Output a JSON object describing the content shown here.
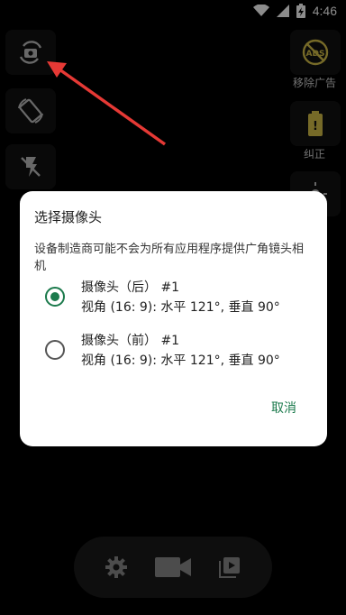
{
  "status": {
    "time": "4:46"
  },
  "right_rail": {
    "ads_label": "移除广告",
    "straighten_label": "纠正"
  },
  "dialog": {
    "title": "选择摄像头",
    "description": "设备制造商可能不会为所有应用程序提供广角镜头相机",
    "options": [
      {
        "title": "摄像头（后） #1",
        "detail": "视角 (16: 9): 水平 121°, 垂直 90°",
        "selected": true
      },
      {
        "title": "摄像头（前） #1",
        "detail": "视角 (16: 9): 水平 121°, 垂直 90°",
        "selected": false
      }
    ],
    "cancel_label": "取消"
  },
  "colors": {
    "accent": "#1b7a4c",
    "arrow": "#e53935"
  }
}
